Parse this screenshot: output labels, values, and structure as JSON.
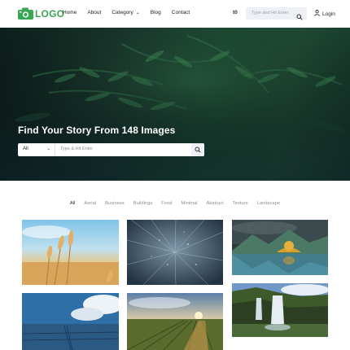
{
  "brand": {
    "logo_text": "LOGO",
    "logo_color": "#3aa655"
  },
  "nav": {
    "items": [
      {
        "label": "Home"
      },
      {
        "label": "About"
      },
      {
        "label": "Category"
      },
      {
        "label": "Blog"
      },
      {
        "label": "Contact"
      }
    ],
    "lang_label": "t0",
    "search_placeholder": "Type and Hit Enter",
    "login_label": "Login"
  },
  "hero": {
    "title": "Find Your Story From 148 Images",
    "select_value": "All",
    "search_placeholder": "Type & Hit Enter"
  },
  "filters": {
    "active": "All",
    "items": [
      "All",
      "Aerial",
      "Business",
      "Buildings",
      "Food",
      "Minimal",
      "Abstract",
      "Texture",
      "Landscape"
    ]
  },
  "gallery": [
    {
      "subject": "wheat field at sunset"
    },
    {
      "subject": "frosted texture close-up"
    },
    {
      "subject": "mountain lake landscape"
    },
    {
      "subject": "ocean pier and clouds"
    },
    {
      "subject": "vineyard at sunset"
    },
    {
      "subject": "waterfall canyon"
    }
  ]
}
